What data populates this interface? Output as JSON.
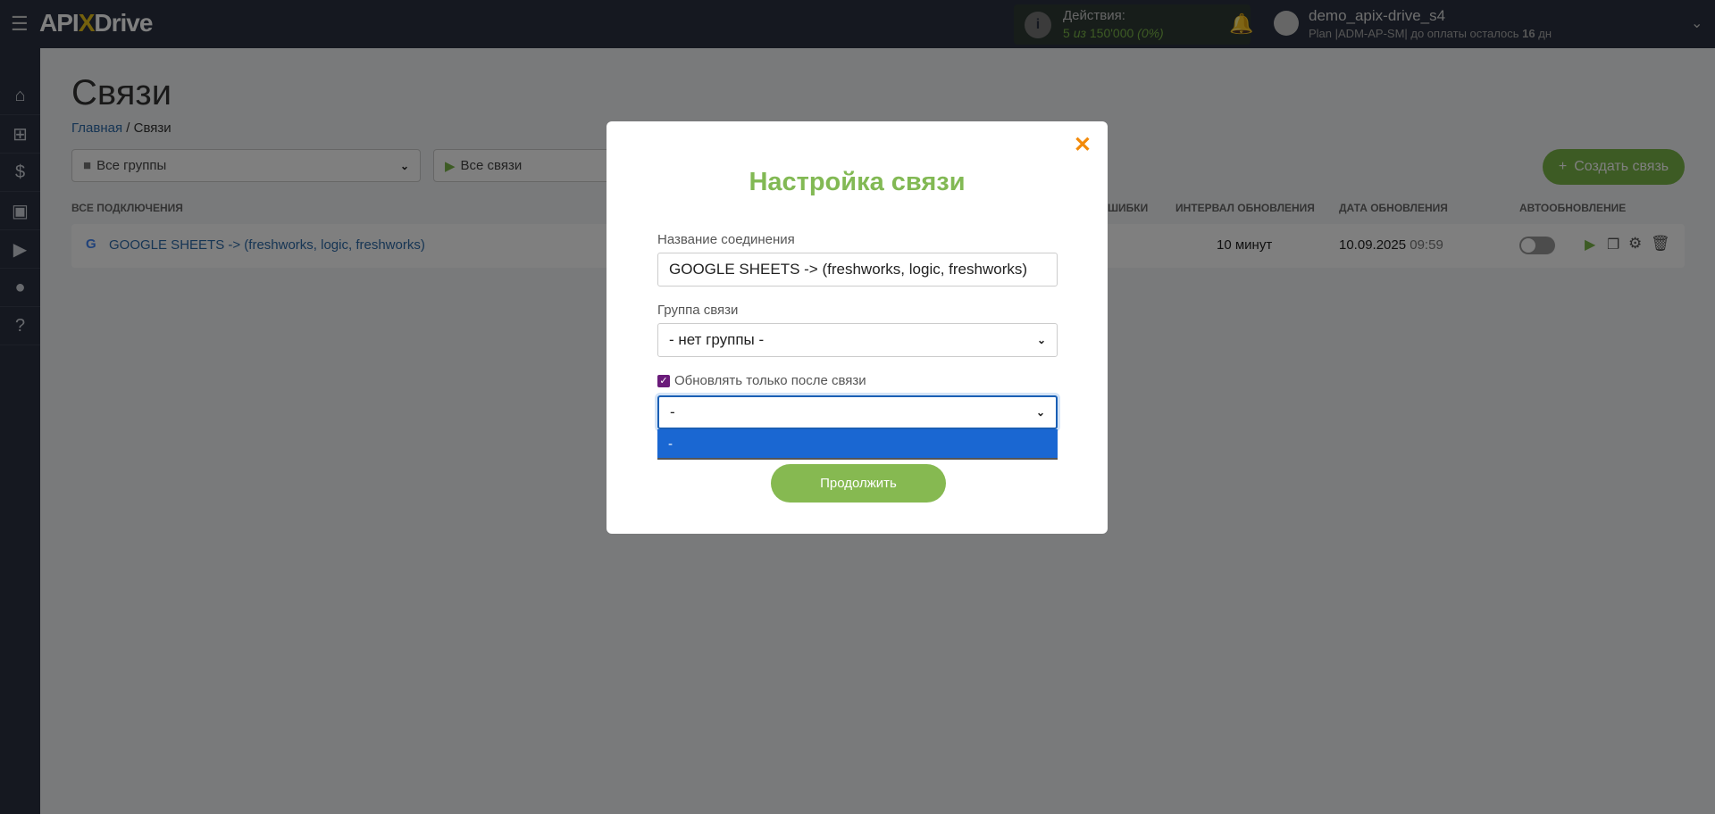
{
  "topbar": {
    "logo_pre": "API",
    "logo_x": "X",
    "logo_post": "Drive",
    "actions_label": "Действия:",
    "actions_used": "5",
    "actions_of": "из",
    "actions_total": "150'000",
    "actions_pct": "(0%)",
    "username": "demo_apix-drive_s4",
    "plan": "Plan |ADM-AP-SM| до оплаты осталось",
    "days": "16",
    "days_unit": "дн"
  },
  "page": {
    "title": "Связи",
    "breadcrumb_home": "Главная",
    "breadcrumb_sep": "/",
    "breadcrumb_current": "Связи"
  },
  "filters": {
    "groups": "Все группы",
    "connections": "Все связи"
  },
  "create_button": "Создать связь",
  "table": {
    "headers": {
      "all": "ВСЕ ПОДКЛЮЧЕНИЯ",
      "errors": "ШИБКИ",
      "interval": "ИНТЕРВАЛ ОБНОВЛЕНИЯ",
      "date": "ДАТА ОБНОВЛЕНИЯ",
      "auto": "АВТООБНОВЛЕНИЕ"
    },
    "rows": [
      {
        "name": "GOOGLE SHEETS -> (freshworks, logic, freshworks)",
        "interval": "10 минут",
        "date": "10.09.2025",
        "time": "09:59"
      }
    ]
  },
  "modal": {
    "title": "Настройка связи",
    "name_label": "Название соединения",
    "name_value": "GOOGLE SHEETS -> (freshworks, logic, freshworks)",
    "group_label": "Группа связи",
    "group_value": "- нет группы -",
    "checkbox_label": "Обновлять только после связи",
    "after_value": "-",
    "dropdown_options": [
      "-"
    ],
    "continue": "Продолжить"
  },
  "colors": {
    "accent": "#82b954",
    "close": "#f28a0a",
    "option_highlight": "#1a67d2"
  }
}
